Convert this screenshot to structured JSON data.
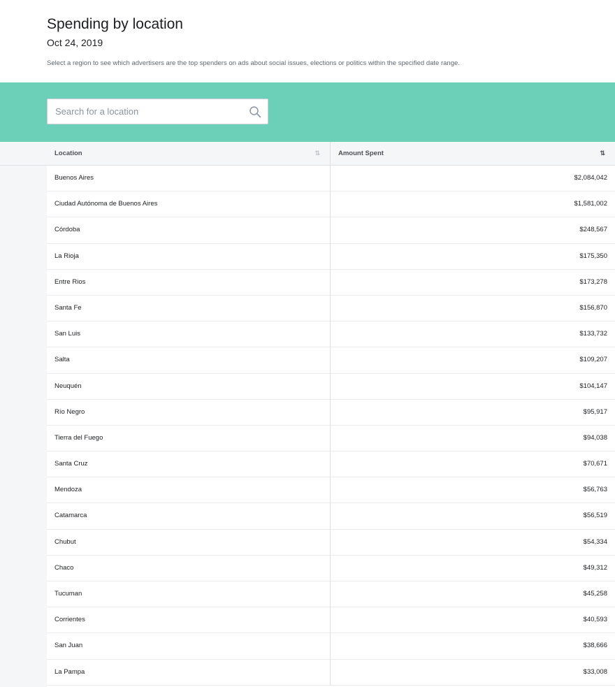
{
  "header": {
    "title": "Spending by location",
    "date": "Oct 24, 2019",
    "description": "Select a region to see which advertisers are the top spenders on ads about social issues, elections or politics within the specified date range."
  },
  "search": {
    "placeholder": "Search for a location",
    "icon": "search-icon"
  },
  "colors": {
    "band": "#6ccfb8",
    "header_bg": "#f5f6f7"
  },
  "table": {
    "columns": [
      {
        "label": "Location",
        "sort_icon": "sort-icon"
      },
      {
        "label": "Amount Spent",
        "sort_icon": "sort-icon"
      }
    ],
    "sort_glyph": "⇅",
    "rows": [
      {
        "location": "Buenos Aires",
        "amount": "$2,084,042"
      },
      {
        "location": "Ciudad Autónoma de Buenos Aires",
        "amount": "$1,581,002"
      },
      {
        "location": "Córdoba",
        "amount": "$248,567"
      },
      {
        "location": "La Rioja",
        "amount": "$175,350"
      },
      {
        "location": "Entre Rios",
        "amount": "$173,278"
      },
      {
        "location": "Santa Fe",
        "amount": "$156,870"
      },
      {
        "location": "San Luis",
        "amount": "$133,732"
      },
      {
        "location": "Salta",
        "amount": "$109,207"
      },
      {
        "location": "Neuquén",
        "amount": "$104,147"
      },
      {
        "location": "Río Negro",
        "amount": "$95,917"
      },
      {
        "location": "Tierra del Fuego",
        "amount": "$94,038"
      },
      {
        "location": "Santa Cruz",
        "amount": "$70,671"
      },
      {
        "location": "Mendoza",
        "amount": "$56,763"
      },
      {
        "location": "Catamarca",
        "amount": "$56,519"
      },
      {
        "location": "Chubut",
        "amount": "$54,334"
      },
      {
        "location": "Chaco",
        "amount": "$49,312"
      },
      {
        "location": "Tucuman",
        "amount": "$45,258"
      },
      {
        "location": "Corrientes",
        "amount": "$40,593"
      },
      {
        "location": "San Juan",
        "amount": "$38,666"
      },
      {
        "location": "La Pampa",
        "amount": "$33,008"
      }
    ]
  }
}
